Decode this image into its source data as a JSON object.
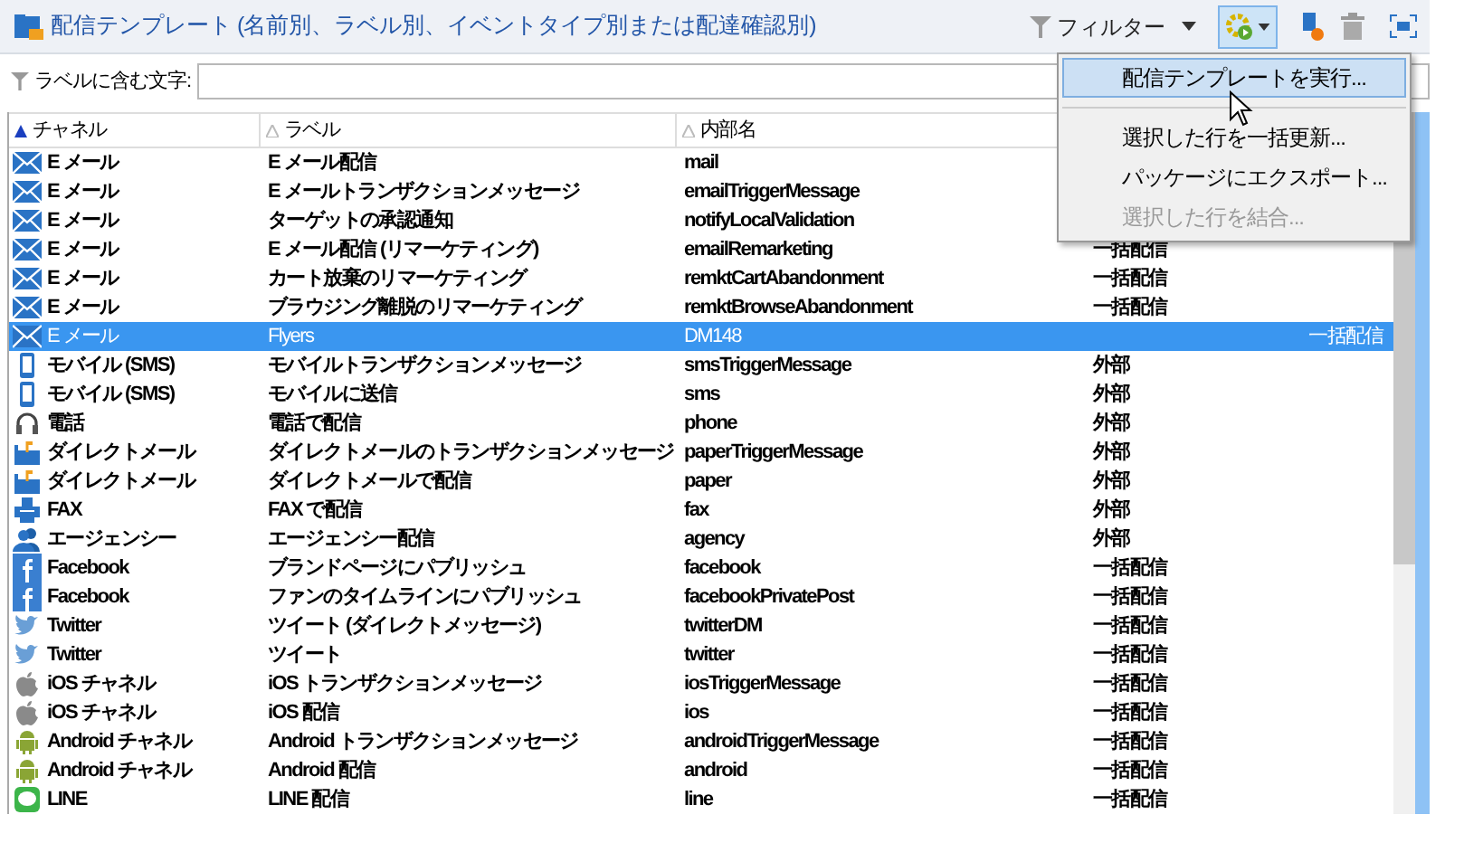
{
  "title": "配信テンプレート (名前別、ラベル別、イベントタイプ別または配達確認別)",
  "toolbar": {
    "filter_label": "フィルター"
  },
  "search": {
    "label": "ラベルに含む文字:"
  },
  "table": {
    "columns": [
      {
        "label": "チャネル",
        "sorted": true,
        "kind": "channel"
      },
      {
        "label": "ラベル",
        "sorted": false,
        "kind": "label"
      },
      {
        "label": "内部名",
        "sorted": false,
        "kind": "internal"
      }
    ],
    "rows": [
      {
        "kind": "email",
        "channel": "E メール",
        "label": "E メール配信",
        "internal": "mail",
        "selected": false
      },
      {
        "kind": "email",
        "channel": "E メール",
        "label": "E メールトランザクションメッセージ",
        "internal": "emailTriggerMessage",
        "selected": false
      },
      {
        "kind": "email",
        "channel": "E メール",
        "label": "ターゲットの承認通知",
        "internal": "notifyLocalValidation",
        "selected": false
      },
      {
        "kind": "email",
        "channel": "E メール",
        "label": "E メール配信 (リマーケティング)",
        "internal": "emailRemarketing",
        "mode": "一括配信",
        "selected": false
      },
      {
        "kind": "email",
        "channel": "E メール",
        "label": "カート放棄のリマーケティング",
        "internal": "remktCartAbandonment",
        "mode": "一括配信",
        "selected": false
      },
      {
        "kind": "email",
        "channel": "E メール",
        "label": "ブラウジング離脱のリマーケティング",
        "internal": "remktBrowseAbandonment",
        "mode": "一括配信",
        "selected": false
      },
      {
        "kind": "email",
        "channel": "E メール",
        "label": "Flyers",
        "internal": "DM148",
        "mode": "一括配信",
        "selected": true
      },
      {
        "kind": "sms",
        "channel": "モバイル (SMS)",
        "label": "モバイルトランザクションメッセージ",
        "internal": "smsTriggerMessage",
        "mode": "外部",
        "selected": false
      },
      {
        "kind": "sms",
        "channel": "モバイル (SMS)",
        "label": "モバイルに送信",
        "internal": "sms",
        "mode": "外部",
        "selected": false
      },
      {
        "kind": "phone",
        "channel": "電話",
        "label": "電話で配信",
        "internal": "phone",
        "mode": "外部",
        "selected": false
      },
      {
        "kind": "mail",
        "channel": "ダイレクトメール",
        "label": "ダイレクトメールのトランザクションメッセージ",
        "internal": "paperTriggerMessage",
        "mode": "外部",
        "selected": false
      },
      {
        "kind": "mail",
        "channel": "ダイレクトメール",
        "label": "ダイレクトメールで配信",
        "internal": "paper",
        "mode": "外部",
        "selected": false
      },
      {
        "kind": "fax",
        "channel": "FAX",
        "label": "FAX で配信",
        "internal": "fax",
        "mode": "外部",
        "selected": false
      },
      {
        "kind": "agency",
        "channel": "エージェンシー",
        "label": "エージェンシー配信",
        "internal": "agency",
        "mode": "外部",
        "selected": false
      },
      {
        "kind": "facebook",
        "channel": "Facebook",
        "label": "ブランドページにパブリッシュ",
        "internal": "facebook",
        "mode": "一括配信",
        "selected": false
      },
      {
        "kind": "facebook",
        "channel": "Facebook",
        "label": "ファンのタイムラインにパブリッシュ",
        "internal": "facebookPrivatePost",
        "mode": "一括配信",
        "selected": false
      },
      {
        "kind": "twitter",
        "channel": "Twitter",
        "label": "ツイート (ダイレクトメッセージ)",
        "internal": "twitterDM",
        "mode": "一括配信",
        "selected": false
      },
      {
        "kind": "twitter",
        "channel": "Twitter",
        "label": "ツイート",
        "internal": "twitter",
        "mode": "一括配信",
        "selected": false
      },
      {
        "kind": "ios",
        "channel": "iOS チャネル",
        "label": "iOS トランザクションメッセージ",
        "internal": "iosTriggerMessage",
        "mode": "一括配信",
        "selected": false
      },
      {
        "kind": "ios",
        "channel": "iOS チャネル",
        "label": "iOS 配信",
        "internal": "ios",
        "mode": "一括配信",
        "selected": false
      },
      {
        "kind": "android",
        "channel": "Android チャネル",
        "label": "Android トランザクションメッセージ",
        "internal": "androidTriggerMessage",
        "mode": "一括配信",
        "selected": false
      },
      {
        "kind": "android",
        "channel": "Android チャネル",
        "label": "Android 配信",
        "internal": "android",
        "mode": "一括配信",
        "selected": false
      },
      {
        "kind": "line",
        "channel": "LINE",
        "label": "LINE 配信",
        "internal": "line",
        "mode": "一括配信",
        "selected": false
      }
    ]
  },
  "menu": {
    "items": [
      {
        "label": "配信テンプレートを実行...",
        "selected": true,
        "disabled": false
      },
      {
        "label": "選択した行を一括更新...",
        "selected": false,
        "disabled": false
      },
      {
        "label": "パッケージにエクスポート...",
        "selected": false,
        "disabled": false
      },
      {
        "label": "選択した行を結合...",
        "selected": false,
        "disabled": true
      }
    ]
  }
}
